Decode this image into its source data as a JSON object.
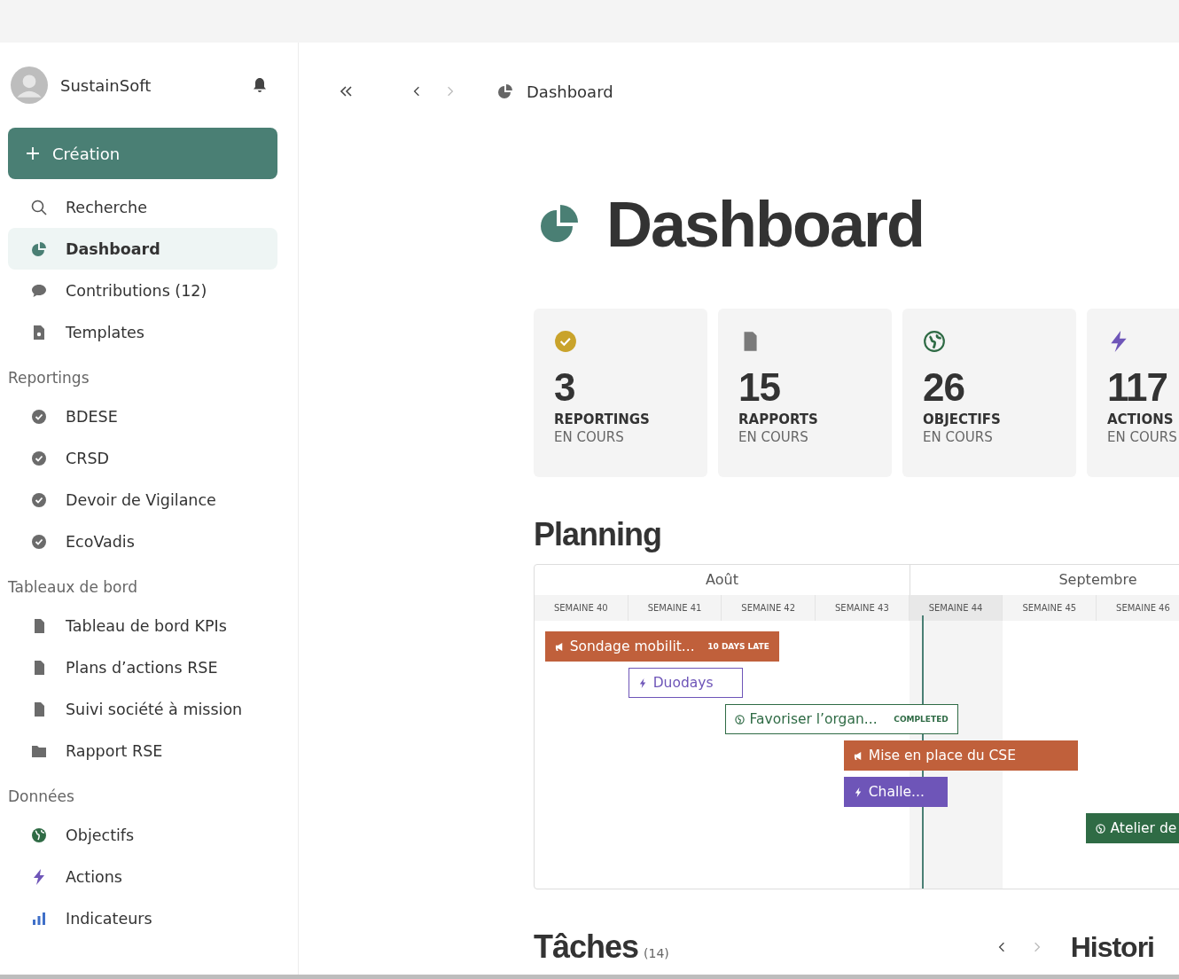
{
  "sidebar": {
    "org": "SustainSoft",
    "create_button": "Création",
    "nav": [
      {
        "label": "Recherche",
        "kind": "search",
        "selected": false
      },
      {
        "label": "Dashboard",
        "kind": "dashboard",
        "selected": true
      },
      {
        "label": "Contributions (12)",
        "kind": "contributions",
        "selected": false
      },
      {
        "label": "Templates",
        "kind": "templates",
        "selected": false
      }
    ],
    "sections": [
      {
        "title": "Reportings",
        "items": [
          {
            "label": "BDESE",
            "kind": "reporting"
          },
          {
            "label": "CRSD",
            "kind": "reporting"
          },
          {
            "label": "Devoir de Vigilance",
            "kind": "reporting"
          },
          {
            "label": "EcoVadis",
            "kind": "reporting"
          }
        ]
      },
      {
        "title": "Tableaux de bord",
        "items": [
          {
            "label": "Tableau de bord KPIs",
            "kind": "document"
          },
          {
            "label": "Plans d’actions RSE",
            "kind": "document"
          },
          {
            "label": "Suivi société à mission",
            "kind": "document"
          },
          {
            "label": "Rapport RSE",
            "kind": "folder"
          }
        ]
      },
      {
        "title": "Données",
        "items": [
          {
            "label": "Objectifs",
            "kind": "objective"
          },
          {
            "label": "Actions",
            "kind": "action"
          },
          {
            "label": "Indicateurs",
            "kind": "indicator"
          }
        ]
      }
    ]
  },
  "breadcrumb": "Dashboard",
  "title": "Dashboard",
  "stats": [
    {
      "value": "3",
      "label": "REPORTINGS",
      "sub": "EN COURS",
      "kind": "reporting"
    },
    {
      "value": "15",
      "label": "RAPPORTS",
      "sub": "EN COURS",
      "kind": "document"
    },
    {
      "value": "26",
      "label": "OBJECTIFS",
      "sub": "EN COURS",
      "kind": "objective"
    },
    {
      "value": "117",
      "label": "ACTIONS",
      "sub": "EN COURS",
      "kind": "action"
    }
  ],
  "planning": {
    "title": "Planning",
    "months": [
      "Août",
      "Septembre"
    ],
    "weeks": [
      {
        "label": "SEMAINE 40",
        "current": false
      },
      {
        "label": "SEMAINE 41",
        "current": false
      },
      {
        "label": "SEMAINE 42",
        "current": false
      },
      {
        "label": "SEMAINE 43",
        "current": false
      },
      {
        "label": "SEMAINE 44",
        "current": true
      },
      {
        "label": "SEMAINE 45",
        "current": false
      },
      {
        "label": "SEMAINE 46",
        "current": false
      }
    ],
    "bars": [
      {
        "label": "Sondage mobilit...",
        "tag": "10 DAYS LATE",
        "kind": "campaign",
        "outlined": false,
        "color": "#c0603b"
      },
      {
        "label": "Duodays",
        "kind": "action",
        "outlined": true,
        "color": "#6e55b8"
      },
      {
        "label": "Favoriser l’organ...",
        "tag": "COMPLETED",
        "kind": "objective",
        "outlined": true,
        "color": "#2f6b45"
      },
      {
        "label": "Mise en place du CSE",
        "kind": "campaign",
        "outlined": false,
        "color": "#c0603b"
      },
      {
        "label": "Challe...",
        "kind": "action",
        "outlined": false,
        "color": "#6e55b8"
      },
      {
        "label": "Atelier de",
        "kind": "objective",
        "outlined": false,
        "color": "#2f6b45"
      }
    ]
  },
  "tasks": {
    "title": "Tâches",
    "count": "(14)"
  },
  "history": {
    "title": "Histori"
  }
}
